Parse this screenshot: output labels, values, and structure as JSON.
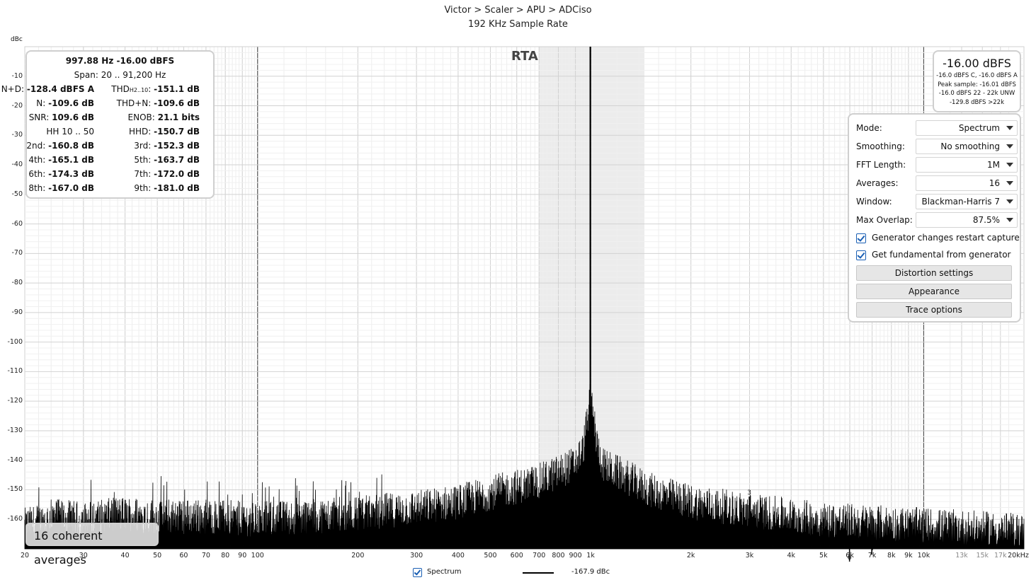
{
  "title": {
    "line1": "Victor > Scaler > APU > ADCiso",
    "line2": "192 KHz Sample Rate"
  },
  "y_unit": "dBc",
  "rta_label": "RTA",
  "stats": {
    "header": "997.88 Hz  -16.00 dBFS",
    "span": "Span: 20 .. 91,200 Hz",
    "rows": [
      {
        "l1": "N+D:",
        "v1": "-128.4 dBFS A",
        "l2": "THD",
        "sub2": "H2..10",
        "l2b": ":",
        "v2": "-151.1 dB"
      },
      {
        "l1": "N:",
        "v1": "-109.6 dB",
        "l2": "THD+N:",
        "v2": "-109.6 dB"
      },
      {
        "l1": "SNR:",
        "v1": "109.6 dB",
        "l2": "ENOB:",
        "v2": "21.1 bits"
      },
      {
        "l1": "HH 10 .. 50",
        "v1": "",
        "l2": "HHD:",
        "v2": "-150.7 dB"
      },
      {
        "l1": "2nd:",
        "v1": "-160.8 dB",
        "l2": "3rd:",
        "v2": "-152.3 dB"
      },
      {
        "l1": "4th:",
        "v1": "-165.1 dB",
        "l2": "5th:",
        "v2": "-163.7 dB"
      },
      {
        "l1": "6th:",
        "v1": "-174.3 dB",
        "l2": "7th:",
        "v2": "-172.0 dB"
      },
      {
        "l1": "8th:",
        "v1": "-167.0 dB",
        "l2": "9th:",
        "v2": "-181.0 dB"
      }
    ]
  },
  "level": {
    "main": "-16.00 dBFS",
    "lines": [
      "-16.0 dBFS C, -16.0 dBFS A",
      "Peak sample: -16.01 dBFS",
      "-16.0 dBFS 22 - 22k UNW",
      "-129.8 dBFS >22k"
    ]
  },
  "settings": {
    "rows": [
      {
        "label": "Mode:",
        "value": "Spectrum"
      },
      {
        "label": "Smoothing:",
        "value": "No smoothing"
      },
      {
        "label": "FFT Length:",
        "value": "1M"
      },
      {
        "label": "Averages:",
        "value": "16"
      },
      {
        "label": "Window:",
        "value": "Blackman-Harris 7"
      },
      {
        "label": "Max Overlap:",
        "value": "87.5%"
      }
    ],
    "checks": [
      "Generator changes restart capture",
      "Get fundamental from generator"
    ],
    "buttons": [
      "Distortion settings",
      "Appearance",
      "Trace options"
    ]
  },
  "avg_badge": "16 coherent averages",
  "legend": {
    "name": "Spectrum",
    "value": "-167.9 dBc"
  },
  "chart_data": {
    "type": "line",
    "x_scale": "log",
    "xlim": [
      20,
      20000
    ],
    "ylim": [
      -170,
      0
    ],
    "ylabel": "dBc",
    "y_ticks": [
      -10,
      -20,
      -30,
      -40,
      -50,
      -60,
      -70,
      -80,
      -90,
      -100,
      -110,
      -120,
      -130,
      -140,
      -150,
      -160
    ],
    "x_ticks": [
      {
        "v": 20,
        "t": "20",
        "major": true
      },
      {
        "v": 30,
        "t": "30",
        "major": true
      },
      {
        "v": 40,
        "t": "40",
        "major": true
      },
      {
        "v": 50,
        "t": "50",
        "major": true
      },
      {
        "v": 60,
        "t": "60",
        "major": true
      },
      {
        "v": 70,
        "t": "70",
        "major": true
      },
      {
        "v": 80,
        "t": "80",
        "major": true
      },
      {
        "v": 90,
        "t": "90",
        "major": true
      },
      {
        "v": 100,
        "t": "100",
        "major": true
      },
      {
        "v": 200,
        "t": "200",
        "major": true
      },
      {
        "v": 300,
        "t": "300",
        "major": true
      },
      {
        "v": 400,
        "t": "400",
        "major": true
      },
      {
        "v": 500,
        "t": "500",
        "major": true
      },
      {
        "v": 600,
        "t": "600",
        "major": true
      },
      {
        "v": 700,
        "t": "700",
        "major": true
      },
      {
        "v": 800,
        "t": "800",
        "major": true
      },
      {
        "v": 900,
        "t": "900",
        "major": true
      },
      {
        "v": 1000,
        "t": "1k",
        "major": true
      },
      {
        "v": 2000,
        "t": "2k",
        "major": true
      },
      {
        "v": 3000,
        "t": "3k",
        "major": true
      },
      {
        "v": 4000,
        "t": "4k",
        "major": true
      },
      {
        "v": 5000,
        "t": "5k",
        "major": true
      },
      {
        "v": 6000,
        "t": "6k",
        "major": true
      },
      {
        "v": 7000,
        "t": "7k",
        "major": true
      },
      {
        "v": 8000,
        "t": "8k",
        "major": true
      },
      {
        "v": 9000,
        "t": "9k",
        "major": true
      },
      {
        "v": 10000,
        "t": "10k",
        "major": true
      },
      {
        "v": 13000,
        "t": "13k",
        "major": false
      },
      {
        "v": 15000,
        "t": "15k",
        "major": false
      },
      {
        "v": 17000,
        "t": "17k",
        "major": false
      },
      {
        "v": 20000,
        "t": "20kHz",
        "major": true
      }
    ],
    "highlight_band_hz": [
      700,
      1450
    ],
    "series": [
      {
        "name": "Spectrum",
        "color": "#000000",
        "fundamental": {
          "x": 997.88,
          "y": 0
        },
        "noise_floor": [
          [
            20,
            -166
          ],
          [
            25,
            -163
          ],
          [
            30,
            -164
          ],
          [
            40,
            -162
          ],
          [
            50,
            -163
          ],
          [
            60,
            -163
          ],
          [
            70,
            -163
          ],
          [
            100,
            -164
          ],
          [
            200,
            -162
          ],
          [
            300,
            -160
          ],
          [
            400,
            -158
          ],
          [
            500,
            -155
          ],
          [
            600,
            -153
          ],
          [
            700,
            -151
          ],
          [
            800,
            -148
          ],
          [
            900,
            -145
          ],
          [
            950,
            -140
          ],
          [
            1000,
            -122
          ],
          [
            1050,
            -140
          ],
          [
            1100,
            -146
          ],
          [
            1300,
            -150
          ],
          [
            1500,
            -154
          ],
          [
            2000,
            -158
          ],
          [
            3000,
            -161
          ],
          [
            5000,
            -164
          ],
          [
            10000,
            -166
          ],
          [
            20000,
            -168
          ]
        ],
        "harmonics": [
          {
            "label": "2",
            "x": 1996,
            "y": -160.8
          },
          {
            "label": "3",
            "x": 2994,
            "y": -152.3
          },
          {
            "label": "4",
            "x": 3992,
            "y": -165.1
          },
          {
            "label": "5",
            "x": 4989,
            "y": -163.7
          },
          {
            "label": "6",
            "x": 5987,
            "y": -174.3
          },
          {
            "label": "7",
            "x": 6985,
            "y": -172.0
          },
          {
            "label": "8",
            "x": 7983,
            "y": -167.0
          }
        ]
      }
    ]
  }
}
